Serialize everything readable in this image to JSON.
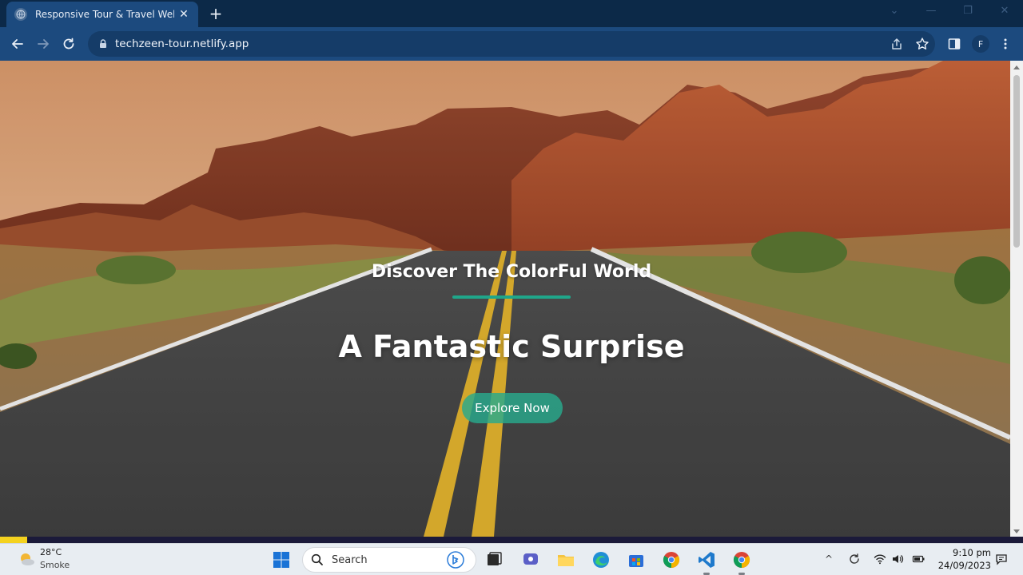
{
  "browser": {
    "tab": {
      "title": "Responsive Tour & Travel Website",
      "close": "✕"
    },
    "new_tab": "+",
    "window_controls": {
      "chevron": "⌄",
      "minimize": "—",
      "restore": "❐",
      "close": "✕"
    },
    "url": "techzeen-tour.netlify.app",
    "profile_initial": "F"
  },
  "hero": {
    "subtitle": "Discover The ColorFul World",
    "title": "A Fantastic Surprise",
    "cta_label": "Explore Now",
    "accent_color": "#1fa68a"
  },
  "taskbar": {
    "weather": {
      "temp": "28°C",
      "condition": "Smoke"
    },
    "search_placeholder": "Search",
    "clock": {
      "time": "9:10 pm",
      "date": "24/09/2023"
    },
    "tray_chevron": "^"
  }
}
